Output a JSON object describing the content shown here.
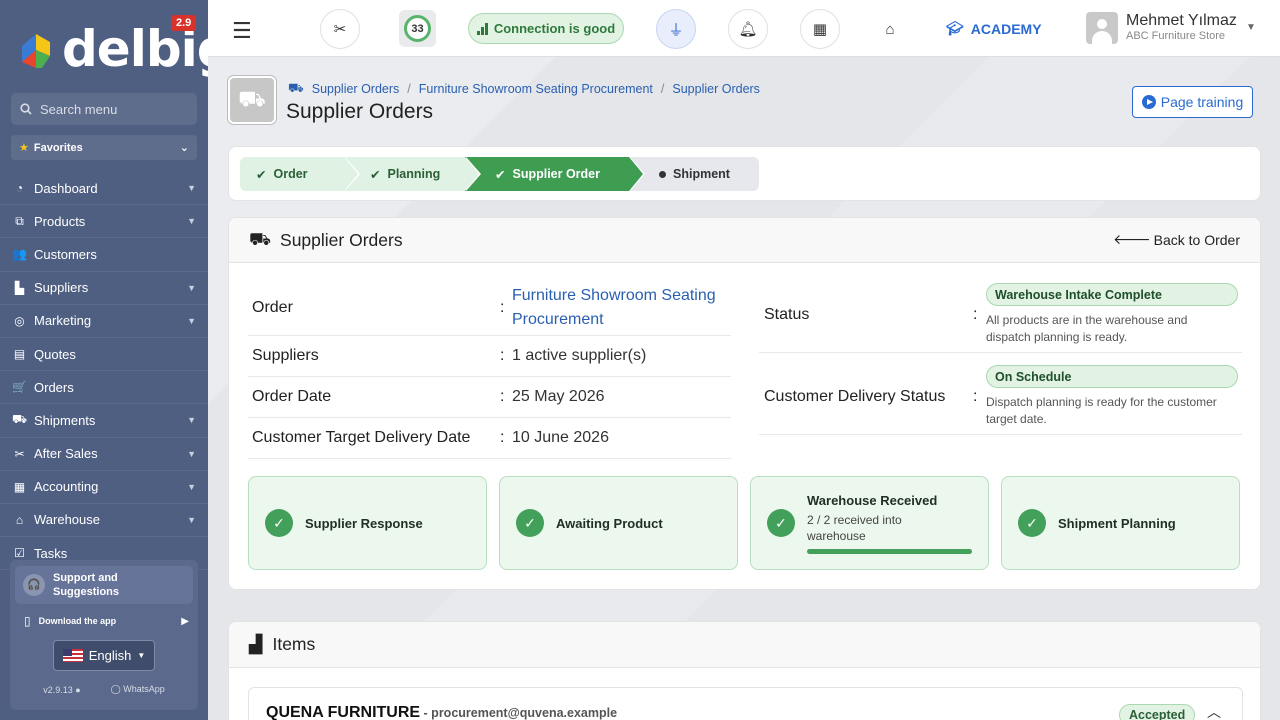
{
  "app": {
    "logo_text": "delbig",
    "version_badge": "2.9"
  },
  "sidebar": {
    "search_placeholder": "Search menu",
    "favorites_label": "Favorites",
    "items": [
      {
        "label": "Dashboard",
        "icon": "dashboard-icon",
        "has_chevron": true
      },
      {
        "label": "Products",
        "icon": "boxes-icon",
        "has_chevron": true
      },
      {
        "label": "Customers",
        "icon": "users-icon",
        "has_chevron": false
      },
      {
        "label": "Suppliers",
        "icon": "industry-icon",
        "has_chevron": true
      },
      {
        "label": "Marketing",
        "icon": "target-icon",
        "has_chevron": true
      },
      {
        "label": "Quotes",
        "icon": "document-icon",
        "has_chevron": false
      },
      {
        "label": "Orders",
        "icon": "cart-icon",
        "has_chevron": false
      },
      {
        "label": "Shipments",
        "icon": "truck-icon",
        "has_chevron": true
      },
      {
        "label": "After Sales",
        "icon": "tools-icon",
        "has_chevron": true
      },
      {
        "label": "Accounting",
        "icon": "calculator-icon",
        "has_chevron": true
      },
      {
        "label": "Warehouse",
        "icon": "warehouse-icon",
        "has_chevron": true
      },
      {
        "label": "Tasks",
        "icon": "tasks-icon",
        "has_chevron": false
      }
    ],
    "support": {
      "title_line1": "Support and",
      "title_line2": "Suggestions",
      "download_label": "Download the app",
      "language": "English",
      "app_version": "v2.9.13",
      "whatsapp_label": "WhatsApp"
    }
  },
  "topbar": {
    "counter": "33",
    "connection": "Connection is good",
    "academy": "ACADEMY",
    "user_name": "Mehmet Yılmaz",
    "user_store": "ABC Furniture Store"
  },
  "page": {
    "breadcrumb": [
      "Supplier Orders",
      "Furniture Showroom Seating Procurement",
      "Supplier Orders"
    ],
    "title": "Supplier Orders",
    "training_button": "Page training"
  },
  "stepper": {
    "steps": [
      {
        "label": "Order",
        "state": "done"
      },
      {
        "label": "Planning",
        "state": "done"
      },
      {
        "label": "Supplier Order",
        "state": "active"
      },
      {
        "label": "Shipment",
        "state": "pending"
      }
    ]
  },
  "order_card": {
    "title": "Supplier Orders",
    "back_button": "Back to Order",
    "fields": {
      "order_label": "Order",
      "order_value_line1": "Furniture Showroom Seating",
      "order_value_line2": "Procurement",
      "suppliers_label": "Suppliers",
      "suppliers_value": "1 active supplier(s)",
      "order_date_label": "Order Date",
      "order_date_value": "25 May 2026",
      "target_label": "Customer Target Delivery Date",
      "target_value": "10 June 2026"
    },
    "status": {
      "label": "Status",
      "badge": "Warehouse Intake Complete",
      "desc_line1": "All products are in the warehouse and",
      "desc_line2": "dispatch planning is ready."
    },
    "delivery_status": {
      "label": "Customer Delivery Status",
      "badge": "On Schedule",
      "desc_line1": "Dispatch planning is ready for the customer",
      "desc_line2": "target date."
    },
    "milestones": [
      {
        "title": "Supplier Response"
      },
      {
        "title": "Awaiting Product"
      },
      {
        "title": "Warehouse Received",
        "sub_line1": "2 / 2 received into",
        "sub_line2": "warehouse",
        "progress": 1.0
      },
      {
        "title": "Shipment Planning"
      }
    ]
  },
  "items_card": {
    "title": "Items",
    "supplier_name": "QUENA FURNITURE",
    "supplier_email": " - procurement@quvena.example",
    "supplier_status": "Accepted"
  },
  "colors": {
    "sidebar_bg": "#4f5f82",
    "accent_blue": "#2a6bd1",
    "success_green": "#43a05a",
    "success_bg": "#e2f3e4",
    "badge_red": "#d9322b"
  }
}
